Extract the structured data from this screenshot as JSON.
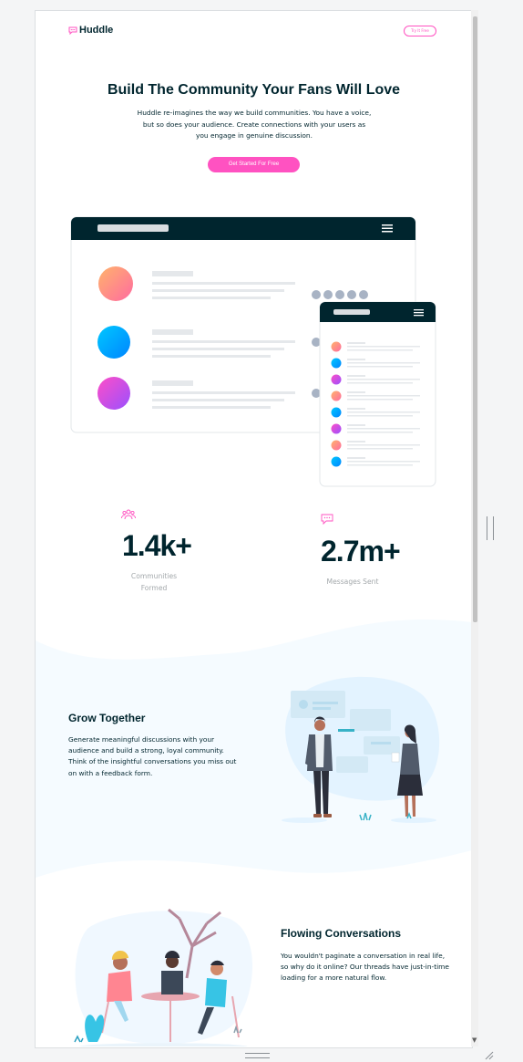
{
  "header": {
    "logo_text": "Huddle",
    "try_button": "Try It Free"
  },
  "hero": {
    "title": "Build The Community Your Fans Will Love",
    "description": "Huddle re-imagines the way we build communities. You have a voice, but so does your audience. Create connections with your users as you engage in genuine discussion.",
    "cta": "Get Started For Free"
  },
  "stats": [
    {
      "value": "1.4k+",
      "label_line1": "Communities",
      "label_line2": "Formed",
      "icon": "communities-icon"
    },
    {
      "value": "2.7m+",
      "label_line1": "Messages Sent",
      "icon": "messages-icon"
    }
  ],
  "features": [
    {
      "title": "Grow Together",
      "description": "Generate meaningful discussions with your audience and build a strong, loyal community. Think of the insightful conversations you miss out on with a feedback form.",
      "illustration": "grow-together-illustration"
    },
    {
      "title": "Flowing Conversations",
      "description": "You wouldn't paginate a conversation in real life, so why do it online? Our threads have just-in-time loading for a more natural flow.",
      "illustration": "flowing-conversations-illustration"
    }
  ],
  "colors": {
    "brand_pink": "#ff52c1",
    "dark_cyan": "#00252e",
    "light_pink_bg": "#f5fbff",
    "gray_text": "#a3a8ab"
  }
}
